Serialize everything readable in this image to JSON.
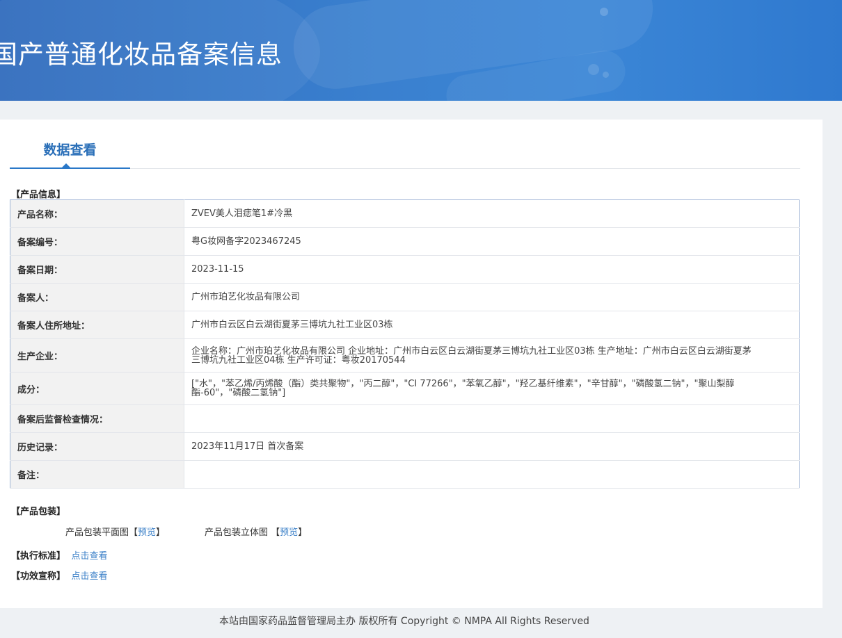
{
  "header": {
    "title": "国产普通化妆品备案信息"
  },
  "tab": {
    "label": "数据查看"
  },
  "product_info": {
    "section_label": "【产品信息】",
    "rows": [
      {
        "key": "产品名称：",
        "value": "ZVEV美人泪痣笔1#冷黑"
      },
      {
        "key": "备案编号：",
        "value": "粤G妆网备字2023467245"
      },
      {
        "key": "备案日期：",
        "value": "2023-11-15"
      },
      {
        "key": "备案人：",
        "value": "广州市珀艺化妆品有限公司"
      },
      {
        "key": "备案人住所地址：",
        "value": "广州市白云区白云湖街夏茅三博坑九社工业区03栋"
      },
      {
        "key": "生产企业：",
        "value": "企业名称：广州市珀艺化妆品有限公司 企业地址：广州市白云区白云湖街夏茅三博坑九社工业区03栋 生产地址：广州市白云区白云湖街夏茅三博坑九社工业区04栋 生产许可证：粤妆20170544"
      },
      {
        "key": "成分：",
        "value": "[\"水\"，\"苯乙烯/丙烯酸（酯）类共聚物\"，\"丙二醇\"，\"CI 77266\"，\"苯氧乙醇\"，\"羟乙基纤维素\"，\"辛甘醇\"，\"磷酸氢二钠\"，\"聚山梨醇酯-60\"，\"磷酸二氢钠\"]"
      },
      {
        "key": "备案后监督检查情况：",
        "value": ""
      },
      {
        "key": "历史记录：",
        "value": "2023年11月17日 首次备案"
      },
      {
        "key": "备注：",
        "value": ""
      }
    ]
  },
  "packaging": {
    "section_label": "【产品包装】",
    "flat_label": "产品包装平面图",
    "flat_link": "预览",
    "solid_label": "产品包装立体图",
    "solid_link": "预览",
    "bracket_open": "【",
    "bracket_close": "】"
  },
  "standard": {
    "label": "【执行标准】",
    "link": "点击查看"
  },
  "efficacy": {
    "label": "【功效宣称】",
    "link": "点击查看"
  },
  "footer": {
    "text": "本站由国家药品监督管理局主办 版权所有 Copyright © NMPA All Rights Reserved"
  }
}
